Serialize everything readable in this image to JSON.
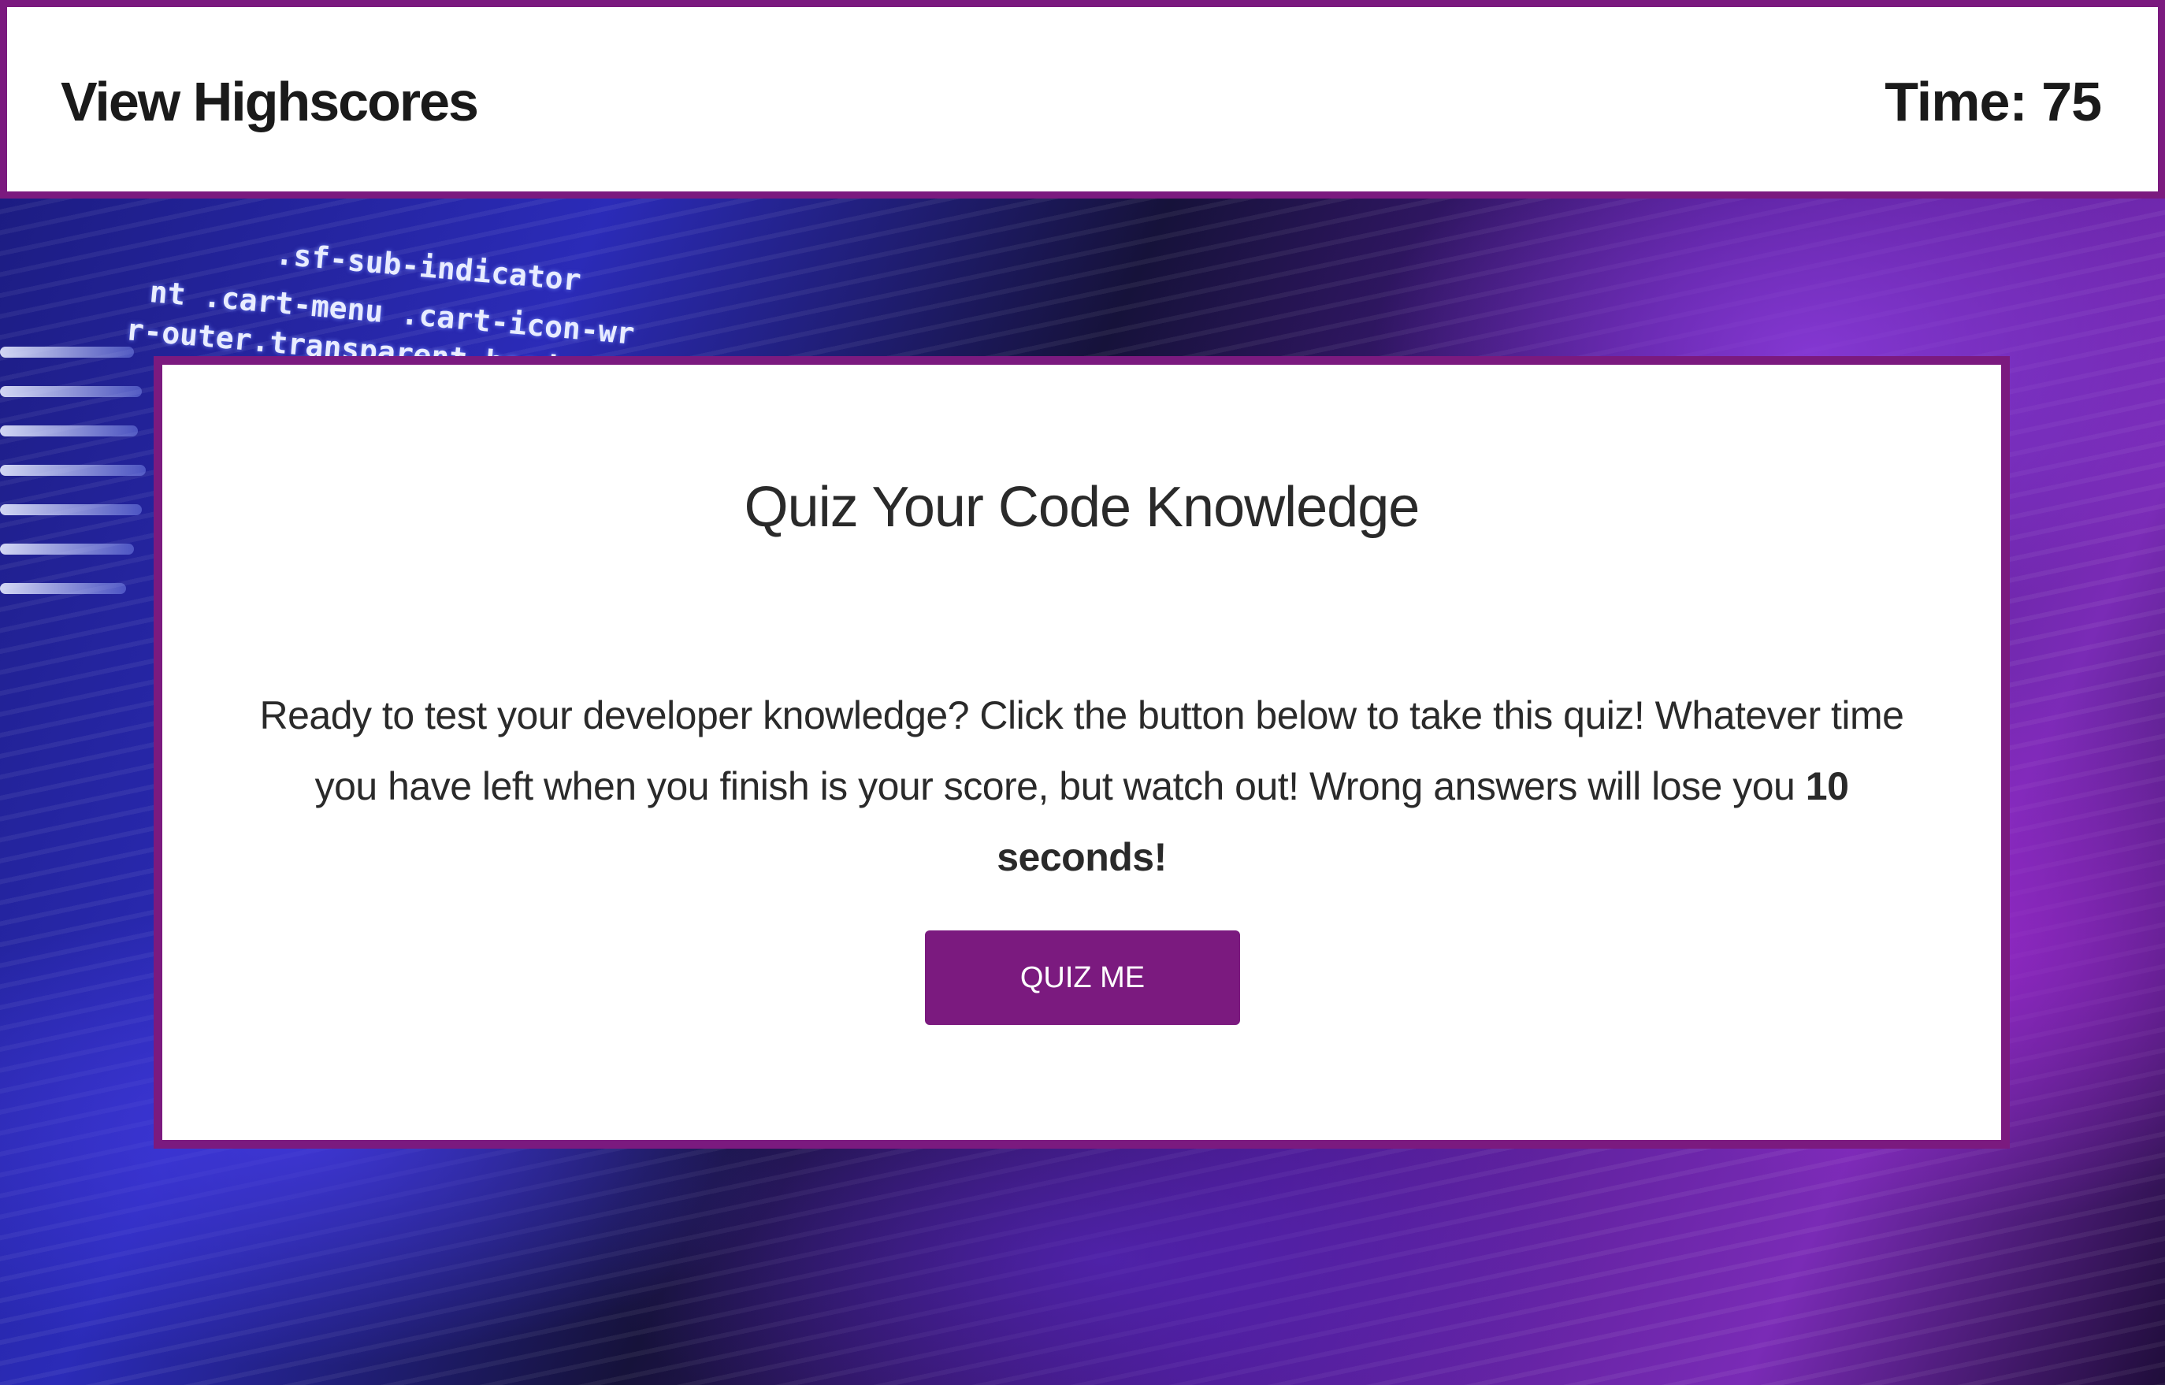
{
  "header": {
    "highscores_label": "View Highscores",
    "timer_label": "Time: 75"
  },
  "background": {
    "code_lines": [
      ".sf-sub-indicator",
      "nt .cart-menu .cart-icon-wr",
      "r-outer.transparent header"
    ]
  },
  "intro_card": {
    "title": "Quiz Your Code Knowledge",
    "description": "Ready to test your developer knowledge? Click the button below to take this quiz! Whatever time you have left when you finish is your score, but watch out! Wrong answers will lose you",
    "penalty": "10 seconds!",
    "start_button_label": "QUIZ ME"
  },
  "colors": {
    "accent": "#7b1a7f",
    "surface": "#ffffff",
    "text": "#2a2a2a"
  }
}
